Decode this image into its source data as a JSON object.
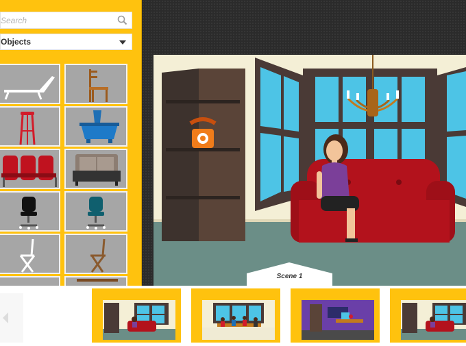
{
  "sidebar": {
    "search_placeholder": "Search",
    "category": "Objects",
    "tiles": [
      "sun lounger",
      "wooden chair",
      "red bar stool",
      "blue planter",
      "cinema seats",
      "sofa",
      "black office chair",
      "teal office chair",
      "white folding chair",
      "wooden folding chair"
    ]
  },
  "scene": {
    "label": "Scene 1"
  },
  "filmstrip": {
    "thumbnails": [
      "scene-1",
      "scene-2",
      "scene-3",
      "scene-4"
    ]
  },
  "colors": {
    "accent": "#ffc20e",
    "stage": "#2b2b2b",
    "wall": "#f4efd6",
    "floor": "#6b8e87",
    "sofa": "#b3121c"
  }
}
